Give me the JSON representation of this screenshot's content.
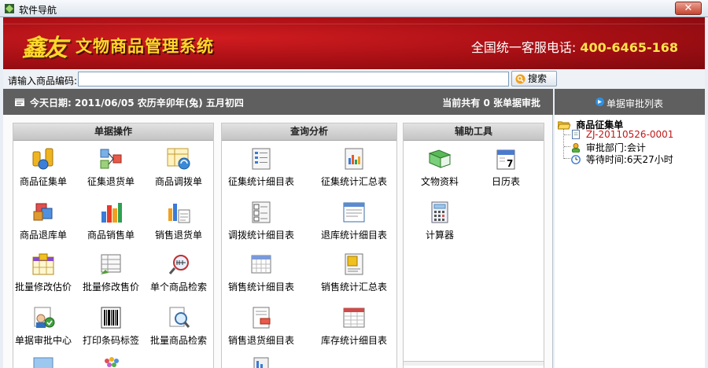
{
  "window": {
    "title": "软件导航",
    "close_label": "✕"
  },
  "banner": {
    "logo_mark": "鑫友",
    "logo_text": "文物商品管理系统",
    "hotline_label": "全国统一客服电话:",
    "hotline_number": "400-6465-168"
  },
  "search": {
    "label": "请输入商品编码:",
    "value": "",
    "placeholder": "",
    "button": "搜索"
  },
  "infobar": {
    "date_text": "今天日期: 2011/06/05 农历辛卯年(兔) 五月初四",
    "pending_text": "当前共有 0 张单据审批"
  },
  "side": {
    "header": "单据审批列表",
    "tree": {
      "root": "商品征集单",
      "items": [
        {
          "icon": "document-icon",
          "text": "ZJ-20110526-0001",
          "color": "#c01818"
        },
        {
          "icon": "user-icon",
          "text": "审批部门:会计"
        },
        {
          "icon": "clock-icon",
          "text": "等待时间:6天27小时"
        }
      ]
    }
  },
  "panels": [
    {
      "title": "单据操作",
      "tools": [
        {
          "label": "商品征集单",
          "icon": "coins-icon"
        },
        {
          "label": "征集退货单",
          "icon": "return-flow-icon"
        },
        {
          "label": "商品调拨单",
          "icon": "transfer-sheet-icon"
        },
        {
          "label": "商品退库单",
          "icon": "cubes-icon"
        },
        {
          "label": "商品销售单",
          "icon": "bar-chart-icon"
        },
        {
          "label": "销售退货单",
          "icon": "chart-sheet-icon"
        },
        {
          "label": "批量修改估价",
          "icon": "calendar-grid-icon"
        },
        {
          "label": "批量修改售价",
          "icon": "table-edit-icon"
        },
        {
          "label": "单个商品检索",
          "icon": "search-scan-icon"
        },
        {
          "label": "单据审批中心",
          "icon": "users-approve-icon"
        },
        {
          "label": "打印条码标签",
          "icon": "barcode-icon"
        },
        {
          "label": "批量商品检索",
          "icon": "magnifier-doc-icon"
        }
      ]
    },
    {
      "title": "查询分析",
      "tools": [
        {
          "label": "征集统计细目表",
          "icon": "list-report-icon"
        },
        {
          "label": "征集统计汇总表",
          "icon": "chart-report-icon"
        },
        {
          "label": "调拨统计细目表",
          "icon": "numbered-list-icon"
        },
        {
          "label": "退库统计细目表",
          "icon": "window-report-icon"
        },
        {
          "label": "销售统计细目表",
          "icon": "calendar-report-icon"
        },
        {
          "label": "销售统计汇总表",
          "icon": "summary-report-icon"
        },
        {
          "label": "销售退货细目表",
          "icon": "doc-return-icon"
        },
        {
          "label": "库存统计细目表",
          "icon": "inventory-table-icon"
        }
      ]
    },
    {
      "title": "辅助工具",
      "tools": [
        {
          "label": "文物资料",
          "icon": "book-icon"
        },
        {
          "label": "日历表",
          "icon": "calendar-icon"
        },
        {
          "label": "计算器",
          "icon": "calculator-icon"
        }
      ]
    }
  ]
}
